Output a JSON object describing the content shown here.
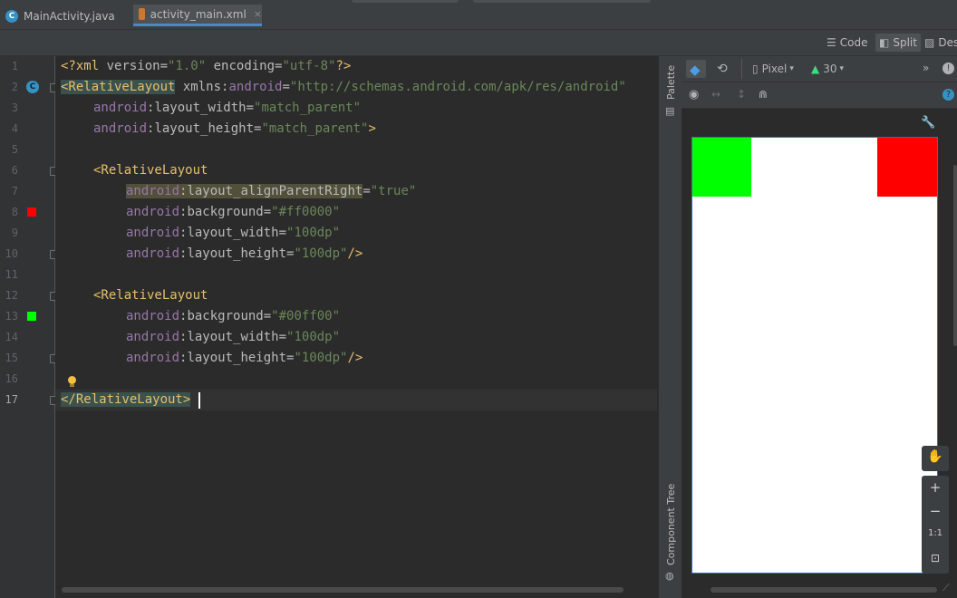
{
  "tabs": [
    {
      "label": "MainActivity.java",
      "icon": "java-class-icon",
      "icon_glyph": "C",
      "active": false
    },
    {
      "label": "activity_main.xml",
      "icon": "xml-file-icon",
      "active": true
    }
  ],
  "tab_close_glyph": "×",
  "view_modes": {
    "code": "Code",
    "split": "Split",
    "design": "Design"
  },
  "gutter": {
    "line_numbers": [
      "1",
      "2",
      "3",
      "4",
      "5",
      "6",
      "7",
      "8",
      "9",
      "10",
      "11",
      "12",
      "13",
      "14",
      "15",
      "16",
      "17"
    ],
    "class_marker": "C"
  },
  "code": {
    "l1": {
      "open": "<?xml",
      "a1": " version=",
      "v1": "\"1.0\"",
      "a2": " encoding=",
      "v2": "\"utf-8\"",
      "close": "?>"
    },
    "l2": {
      "tag": "<RelativeLayout",
      "sp": " ",
      "ns": "xmlns",
      "colon": ":",
      "attr": "android",
      "eq": "=",
      "val": "\"http://schemas.android.com/apk/res/android\""
    },
    "l3": {
      "ns": "android",
      "attr": ":layout_width=",
      "val": "\"match_parent\""
    },
    "l4": {
      "ns": "android",
      "attr": ":layout_height=",
      "val": "\"match_parent\"",
      "close": ">"
    },
    "l6": {
      "tag": "<RelativeLayout"
    },
    "l7": {
      "ns": "android",
      "attr": ":layout_alignParentRight",
      "eq": "=",
      "val": "\"true\""
    },
    "l8": {
      "ns": "android",
      "attr": ":background=",
      "val": "\"#ff0000\""
    },
    "l9": {
      "ns": "android",
      "attr": ":layout_width=",
      "val": "\"100dp\""
    },
    "l10": {
      "ns": "android",
      "attr": ":layout_height=",
      "val": "\"100dp\"",
      "close": "/>"
    },
    "l12": {
      "tag": "<RelativeLayout"
    },
    "l13": {
      "ns": "android",
      "attr": ":background=",
      "val": "\"#00ff00\""
    },
    "l14": {
      "ns": "android",
      "attr": ":layout_width=",
      "val": "\"100dp\""
    },
    "l15": {
      "ns": "android",
      "attr": ":layout_height=",
      "val": "\"100dp\"",
      "close": "/>"
    },
    "l17": {
      "tag": "</RelativeLayout",
      "close": ">"
    }
  },
  "side_panels": {
    "palette": "Palette",
    "component_tree": "Component Tree"
  },
  "design_toolbar": {
    "device": "Pixel",
    "api_level": "30",
    "overflow": "»",
    "help": "?"
  },
  "zoom_controls": {
    "zoom_in": "+",
    "zoom_out": "−",
    "actual_size": "1:1"
  },
  "preview": {
    "red_view_color": "#ff0000",
    "green_view_color": "#00ff00"
  },
  "colors": {
    "accent": "#4a88c7",
    "background": "#2b2b2b",
    "panel": "#3c3f41"
  }
}
